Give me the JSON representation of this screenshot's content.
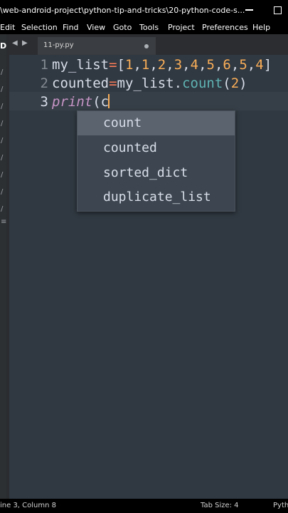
{
  "window": {
    "title": "\\web-android-project\\python-tip-and-tricks\\20-python-code-s..."
  },
  "menu": [
    "Edit",
    "Selection",
    "Find",
    "View",
    "Goto",
    "Tools",
    "Project",
    "Preferences",
    "Help"
  ],
  "sidebar": {
    "label": "D"
  },
  "tab": {
    "filename": "11-py.py"
  },
  "editor": {
    "line_numbers": [
      "1",
      "2",
      "3"
    ],
    "line1": {
      "var": "my_list",
      "eq": "=",
      "open": "[",
      "n1": "1",
      "n2": "1",
      "n3": "2",
      "n4": "3",
      "n5": "4",
      "n6": "5",
      "n7": "6",
      "n8": "5",
      "n9": "4",
      "close": "]"
    },
    "line2": {
      "var": "counted",
      "eq": "=",
      "obj": "my_list",
      "dot": ".",
      "method": "count",
      "open": "(",
      "arg": "2",
      "close": ")"
    },
    "line3": {
      "fn": "print",
      "open": "(",
      "typed": "c"
    }
  },
  "autocomplete": {
    "items": [
      "count",
      "counted",
      "sorted_dict",
      "duplicate_list"
    ],
    "selected_index": 0
  },
  "status": {
    "position": "ine 3, Column 8",
    "tab_size": "Tab Size: 4",
    "syntax": "Pyth"
  },
  "colors": {
    "background": "#303841",
    "operator": "#f97b58",
    "number": "#f9ae58",
    "function": "#5fb4b4",
    "keyword": "#c695c6"
  }
}
